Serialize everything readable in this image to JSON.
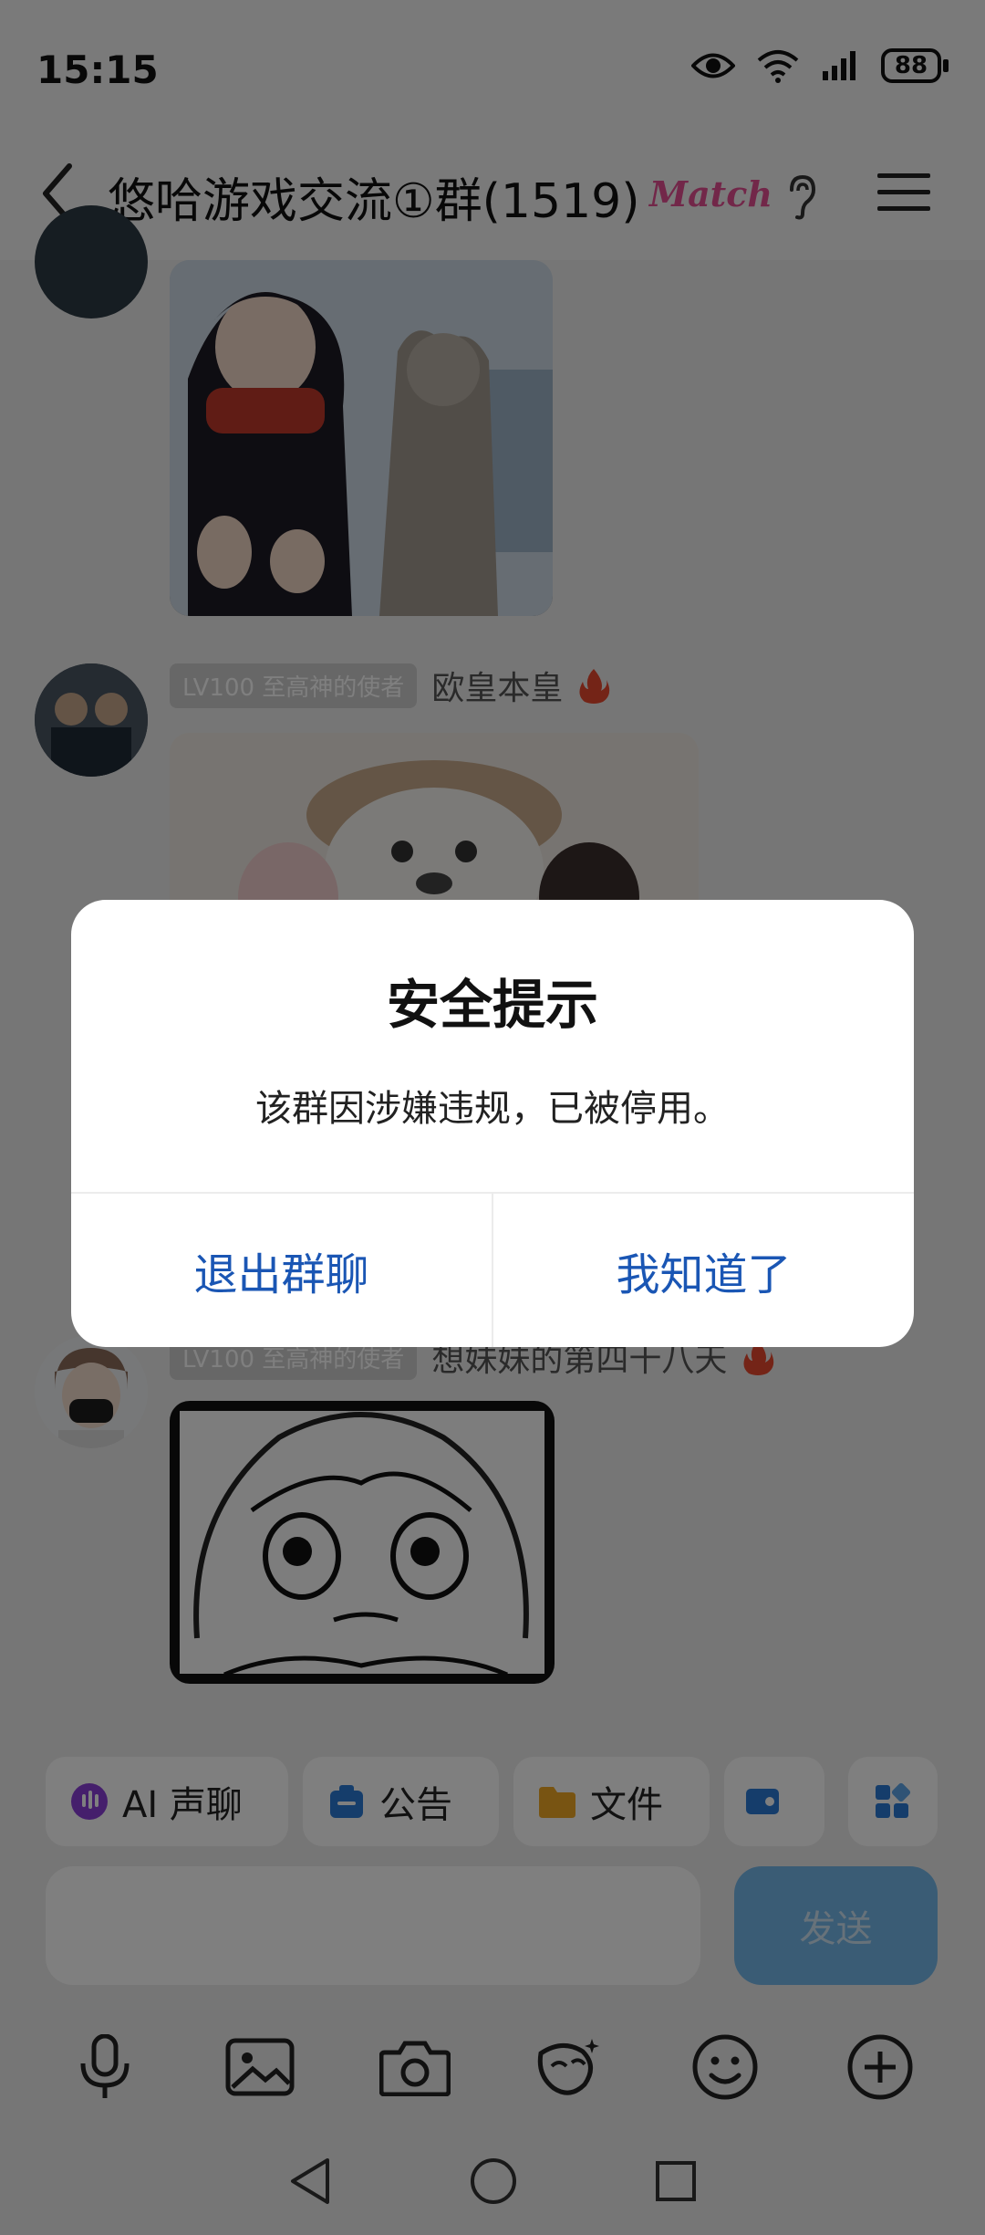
{
  "status_bar": {
    "time": "15:15",
    "battery": "88"
  },
  "header": {
    "title": "悠哈游戏交流①群(1519)",
    "match_badge": "Match"
  },
  "messages": [
    {
      "level": "LV100 至高神的使者",
      "sender": "欧皇本皇"
    },
    {
      "level": "LV100 至高神的使者",
      "sender": "想妹妹的第四十八天"
    }
  ],
  "quick_actions": [
    "AI 声聊",
    "公告",
    "文件"
  ],
  "input": {
    "send_label": "发送"
  },
  "dialog": {
    "title": "安全提示",
    "message": "该群因涉嫌违规，已被停用。",
    "exit_button": "退出群聊",
    "ok_button": "我知道了"
  },
  "colors": {
    "accent": "#1a56b4",
    "send": "#74b8ea",
    "match": "#e44f93"
  }
}
